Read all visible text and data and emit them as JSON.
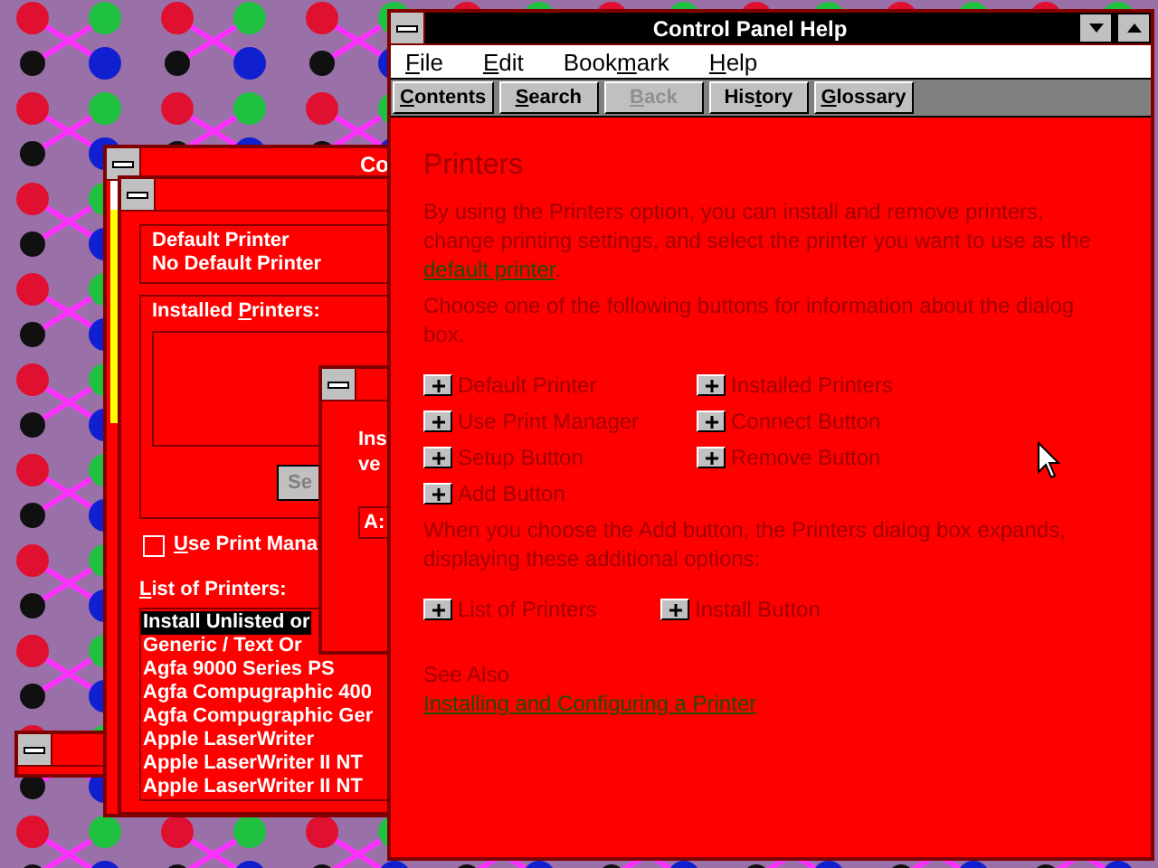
{
  "control_panel": {
    "title": "Co"
  },
  "printers_dialog": {
    "default_printer": {
      "label": "Default Printer",
      "value": "No Default Printer"
    },
    "installed_label": {
      "pre": "Installed ",
      "key": "P",
      "post": "rinters:"
    },
    "setup_button": "Se",
    "use_print_manager": {
      "label": {
        "key": "U",
        "post": "se Print Mana"
      },
      "checked": false
    },
    "list_label": {
      "key": "L",
      "post": "ist of Printers:"
    },
    "printers": [
      {
        "name": "Install Unlisted or",
        "selected": true
      },
      {
        "name": "Generic / Text Or",
        "selected": false
      },
      {
        "name": "Agfa 9000 Series PS",
        "selected": false
      },
      {
        "name": "Agfa Compugraphic 400",
        "selected": false
      },
      {
        "name": "Agfa Compugraphic Ger",
        "selected": false
      },
      {
        "name": "Apple LaserWriter",
        "selected": false
      },
      {
        "name": "Apple LaserWriter II NT",
        "selected": false
      },
      {
        "name": "Apple LaserWriter II NT",
        "selected": false
      }
    ]
  },
  "install_dialog": {
    "lines": [
      "Ins",
      "ve"
    ],
    "drive": "A:"
  },
  "help_window": {
    "title": "Control Panel Help",
    "menu": [
      {
        "key": "F",
        "post": "ile"
      },
      {
        "key": "E",
        "post": "dit"
      },
      {
        "pre": "Book",
        "key": "m",
        "post": "ark"
      },
      {
        "key": "H",
        "post": "elp"
      }
    ],
    "toolbar": [
      {
        "label": {
          "key": "C",
          "post": "ontents"
        },
        "disabled": false
      },
      {
        "label": {
          "key": "S",
          "post": "earch"
        },
        "disabled": false
      },
      {
        "label": {
          "key": "B",
          "post": "ack"
        },
        "disabled": true
      },
      {
        "label": {
          "pre": "His",
          "key": "t",
          "post": "ory"
        },
        "disabled": false
      },
      {
        "label": {
          "key": "G",
          "post": "lossary"
        },
        "disabled": false
      }
    ],
    "heading": "Printers",
    "blocks": [
      {
        "kind": "text",
        "parts": [
          {
            "kind": "plain",
            "text": "By using the Printers option, you can install and remove printers, change printing settings, and select the printer you want to use as the "
          },
          {
            "kind": "link",
            "text": "default printer"
          },
          {
            "kind": "plain",
            "text": "."
          }
        ]
      },
      {
        "kind": "text",
        "parts": [
          {
            "kind": "plain",
            "text": "Choose one of the following buttons for information about the dialog box."
          }
        ]
      },
      {
        "kind": "options",
        "items": [
          "Default Printer",
          "Installed Printers",
          "Use Print Manager",
          "Connect Button",
          "Setup Button",
          "Remove Button",
          "Add Button"
        ]
      },
      {
        "kind": "text",
        "parts": [
          {
            "kind": "plain",
            "text": "When you choose the Add button, the Printers dialog box expands, displaying these additional options:"
          }
        ]
      },
      {
        "kind": "short_options",
        "items": [
          "List of Printers",
          "Install Button"
        ]
      }
    ],
    "see_also": {
      "heading": "See Also",
      "links": [
        "Installing and Configuring a Printer"
      ]
    }
  }
}
